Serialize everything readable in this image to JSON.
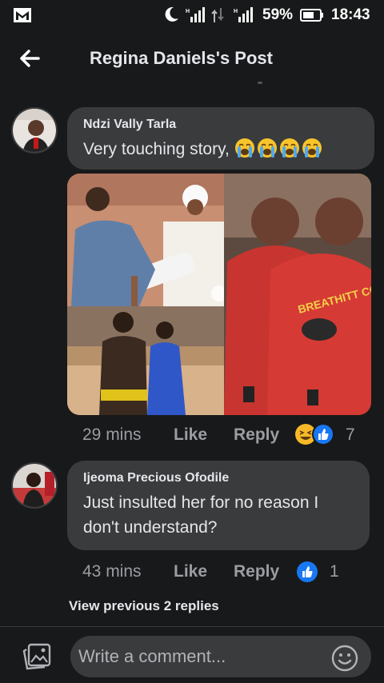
{
  "status_bar": {
    "battery": "59%",
    "time": "18:43",
    "icons": [
      "mail-icon",
      "moon-icon",
      "signal-icon",
      "data-icon",
      "signal-icon",
      "battery-icon"
    ]
  },
  "header": {
    "title": "Regina Daniels's Post",
    "back_icon": "arrow-left-icon"
  },
  "comments": [
    {
      "author": "Ndzi Vally Tarla",
      "text": "Very touching story,",
      "emojis": [
        "loudly-crying-face",
        "loudly-crying-face",
        "loudly-crying-face",
        "loudly-crying-face"
      ],
      "time": "29 mins",
      "like_label": "Like",
      "reply_label": "Reply",
      "reactions": [
        "haha",
        "like"
      ],
      "reaction_count": "7"
    },
    {
      "author": "Ijeoma Precious Ofodile",
      "text": "Just insulted her for no reason I don't understand?",
      "time": "43 mins",
      "like_label": "Like",
      "reply_label": "Reply",
      "reactions": [
        "like"
      ],
      "reaction_count": "1"
    }
  ],
  "view_previous": "View previous 2 replies",
  "composer": {
    "placeholder": "Write a comment...",
    "photo_icon": "photo-icon",
    "emoji_icon": "smile-icon"
  },
  "colors": {
    "background": "#18191a",
    "bubble": "#3a3b3c",
    "text": "#e4e6eb",
    "muted": "#9a9da2",
    "like_blue": "#1877f2",
    "haha_yellow": "#f7b928"
  }
}
